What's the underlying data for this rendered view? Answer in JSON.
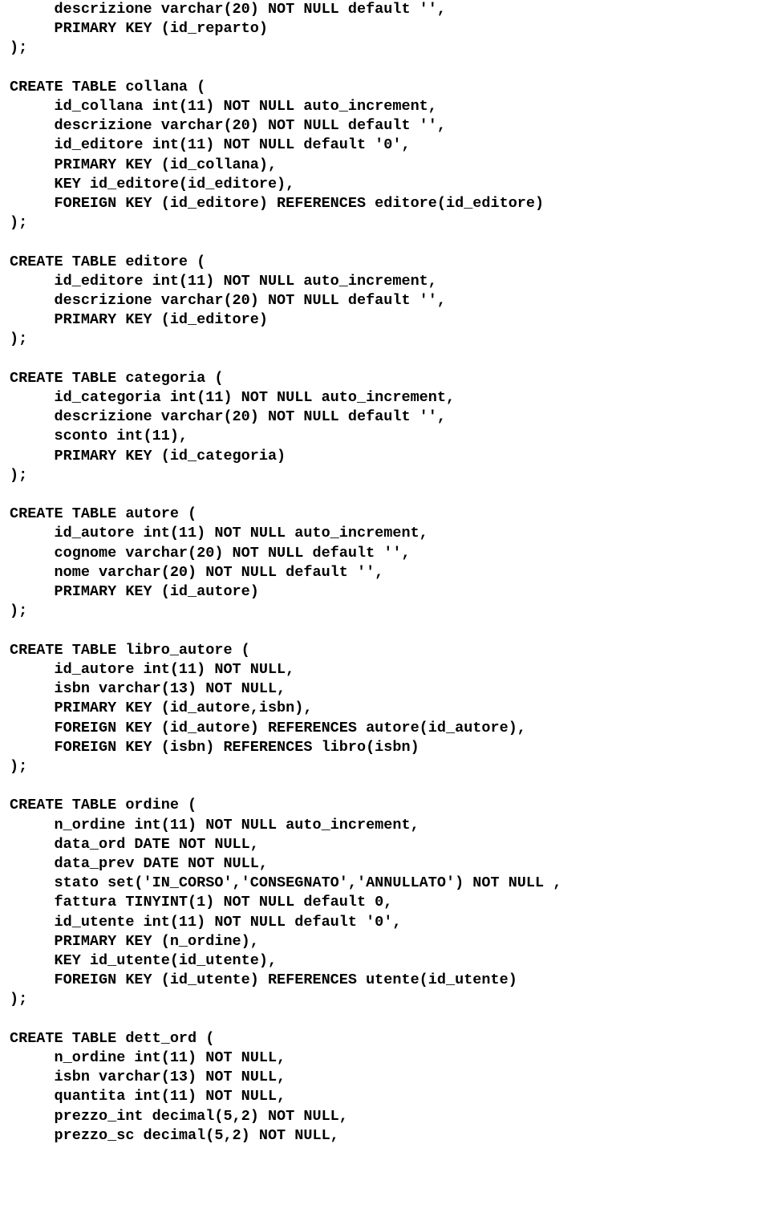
{
  "code": {
    "lines": [
      "     descrizione varchar(20) NOT NULL default '',",
      "     PRIMARY KEY (id_reparto)",
      ");",
      "",
      "CREATE TABLE collana (",
      "     id_collana int(11) NOT NULL auto_increment,",
      "     descrizione varchar(20) NOT NULL default '',",
      "     id_editore int(11) NOT NULL default '0',",
      "     PRIMARY KEY (id_collana),",
      "     KEY id_editore(id_editore),",
      "     FOREIGN KEY (id_editore) REFERENCES editore(id_editore)",
      ");",
      "",
      "CREATE TABLE editore (",
      "     id_editore int(11) NOT NULL auto_increment,",
      "     descrizione varchar(20) NOT NULL default '',",
      "     PRIMARY KEY (id_editore)",
      ");",
      "",
      "CREATE TABLE categoria (",
      "     id_categoria int(11) NOT NULL auto_increment,",
      "     descrizione varchar(20) NOT NULL default '',",
      "     sconto int(11),",
      "     PRIMARY KEY (id_categoria)",
      ");",
      "",
      "CREATE TABLE autore (",
      "     id_autore int(11) NOT NULL auto_increment,",
      "     cognome varchar(20) NOT NULL default '',",
      "     nome varchar(20) NOT NULL default '',",
      "     PRIMARY KEY (id_autore)",
      ");",
      "",
      "CREATE TABLE libro_autore (",
      "     id_autore int(11) NOT NULL,",
      "     isbn varchar(13) NOT NULL,",
      "     PRIMARY KEY (id_autore,isbn),",
      "     FOREIGN KEY (id_autore) REFERENCES autore(id_autore),",
      "     FOREIGN KEY (isbn) REFERENCES libro(isbn)",
      ");",
      "",
      "CREATE TABLE ordine (",
      "     n_ordine int(11) NOT NULL auto_increment,",
      "     data_ord DATE NOT NULL,",
      "     data_prev DATE NOT NULL,",
      "     stato set('IN_CORSO','CONSEGNATO','ANNULLATO') NOT NULL ,",
      "     fattura TINYINT(1) NOT NULL default 0,",
      "     id_utente int(11) NOT NULL default '0',",
      "     PRIMARY KEY (n_ordine),",
      "     KEY id_utente(id_utente),",
      "     FOREIGN KEY (id_utente) REFERENCES utente(id_utente)",
      ");",
      "",
      "CREATE TABLE dett_ord (",
      "     n_ordine int(11) NOT NULL,",
      "     isbn varchar(13) NOT NULL,",
      "     quantita int(11) NOT NULL,",
      "     prezzo_int decimal(5,2) NOT NULL,",
      "     prezzo_sc decimal(5,2) NOT NULL,"
    ]
  }
}
